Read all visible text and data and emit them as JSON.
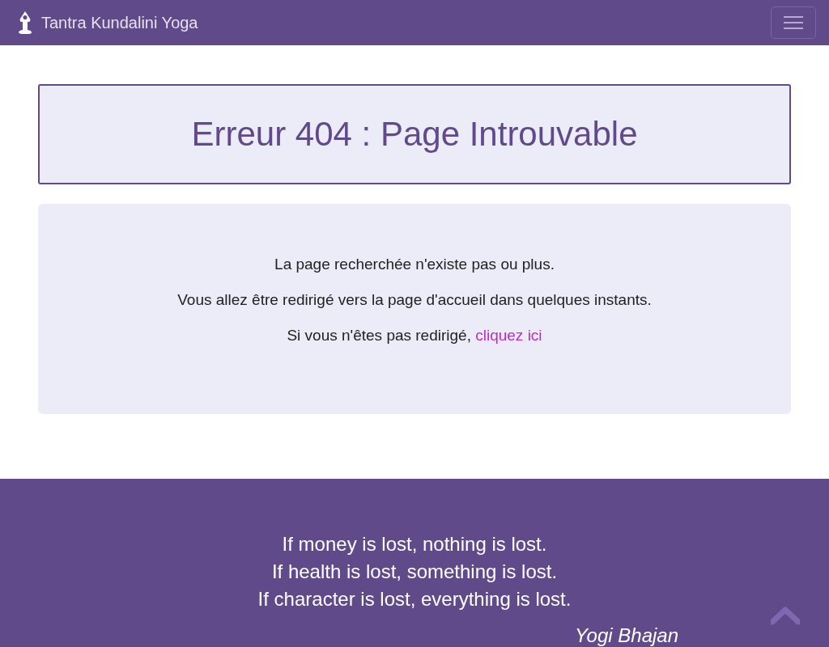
{
  "navbar": {
    "brand": "Tantra Kundalini Yoga"
  },
  "error_title": "Erreur 404 : Page Introuvable",
  "message": {
    "lines": [
      "La page recherchée n'existe pas ou plus.",
      "Vous allez être redirigé vers la page d'accueil dans quelques instants."
    ],
    "redirect_text": "Si vous n'êtes pas redirigé,",
    "redirect_link": "cliquez ici"
  },
  "footer": {
    "quote_lines": [
      "If money is lost, nothing is lost.",
      "If health is lost, something is lost.",
      "If character is lost, everything is lost."
    ],
    "author": "Yogi Bhajan"
  }
}
